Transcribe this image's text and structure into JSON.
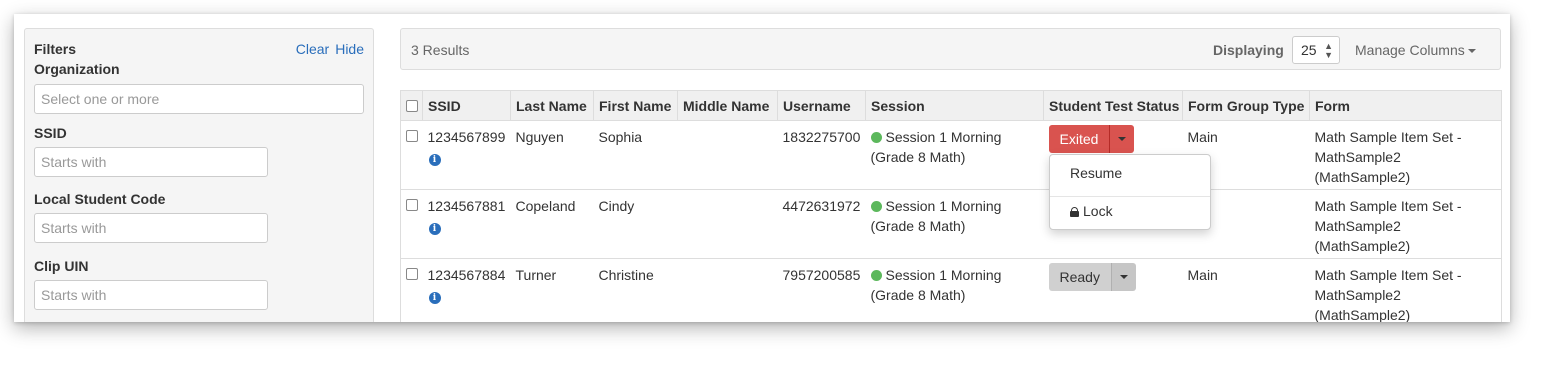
{
  "filters": {
    "title": "Filters",
    "clear_label": "Clear",
    "hide_label": "Hide",
    "organization": {
      "label": "Organization",
      "placeholder": "Select one or more"
    },
    "ssid": {
      "label": "SSID",
      "placeholder": "Starts with"
    },
    "local_code": {
      "label": "Local Student Code",
      "placeholder": "Starts with"
    },
    "clip_uin": {
      "label": "Clip UIN",
      "placeholder": "Starts with"
    }
  },
  "results": {
    "count_text": "3 Results",
    "displaying_label": "Displaying",
    "page_size": "25",
    "manage_columns_label": "Manage Columns"
  },
  "table": {
    "columns": [
      "SSID",
      "Last Name",
      "First Name",
      "Middle Name",
      "Username",
      "Session",
      "Student Test Status",
      "Form Group Type",
      "Form"
    ],
    "rows": [
      {
        "ssid": "1234567899",
        "last": "Nguyen",
        "first": "Sophia",
        "middle": "",
        "username": "1832275700",
        "session": "Session 1 Morning (Grade 8 Math)",
        "status": "Exited",
        "form_group": "Main",
        "form": "Math Sample Item Set - MathSample2 (MathSample2)"
      },
      {
        "ssid": "1234567881",
        "last": "Copeland",
        "first": "Cindy",
        "middle": "",
        "username": "4472631972",
        "session": "Session 1 Morning (Grade 8 Math)",
        "status": "",
        "form_group": "ain",
        "form": "Math Sample Item Set - MathSample2 (MathSample2)"
      },
      {
        "ssid": "1234567884",
        "last": "Turner",
        "first": "Christine",
        "middle": "",
        "username": "7957200585",
        "session": "Session 1 Morning (Grade 8 Math)",
        "status": "Ready",
        "form_group": "Main",
        "form": "Math Sample Item Set - MathSample2 (MathSample2)"
      }
    ]
  },
  "dropdown": {
    "items": [
      "Resume",
      "Lock"
    ]
  },
  "colors": {
    "link": "#2a6ebb",
    "exited": "#d9534f",
    "ready": "#d0d0d0",
    "session_dot": "#5cb85c"
  },
  "icons": [
    "info-icon",
    "lock-icon",
    "caret-down-icon",
    "status-dot-icon"
  ]
}
